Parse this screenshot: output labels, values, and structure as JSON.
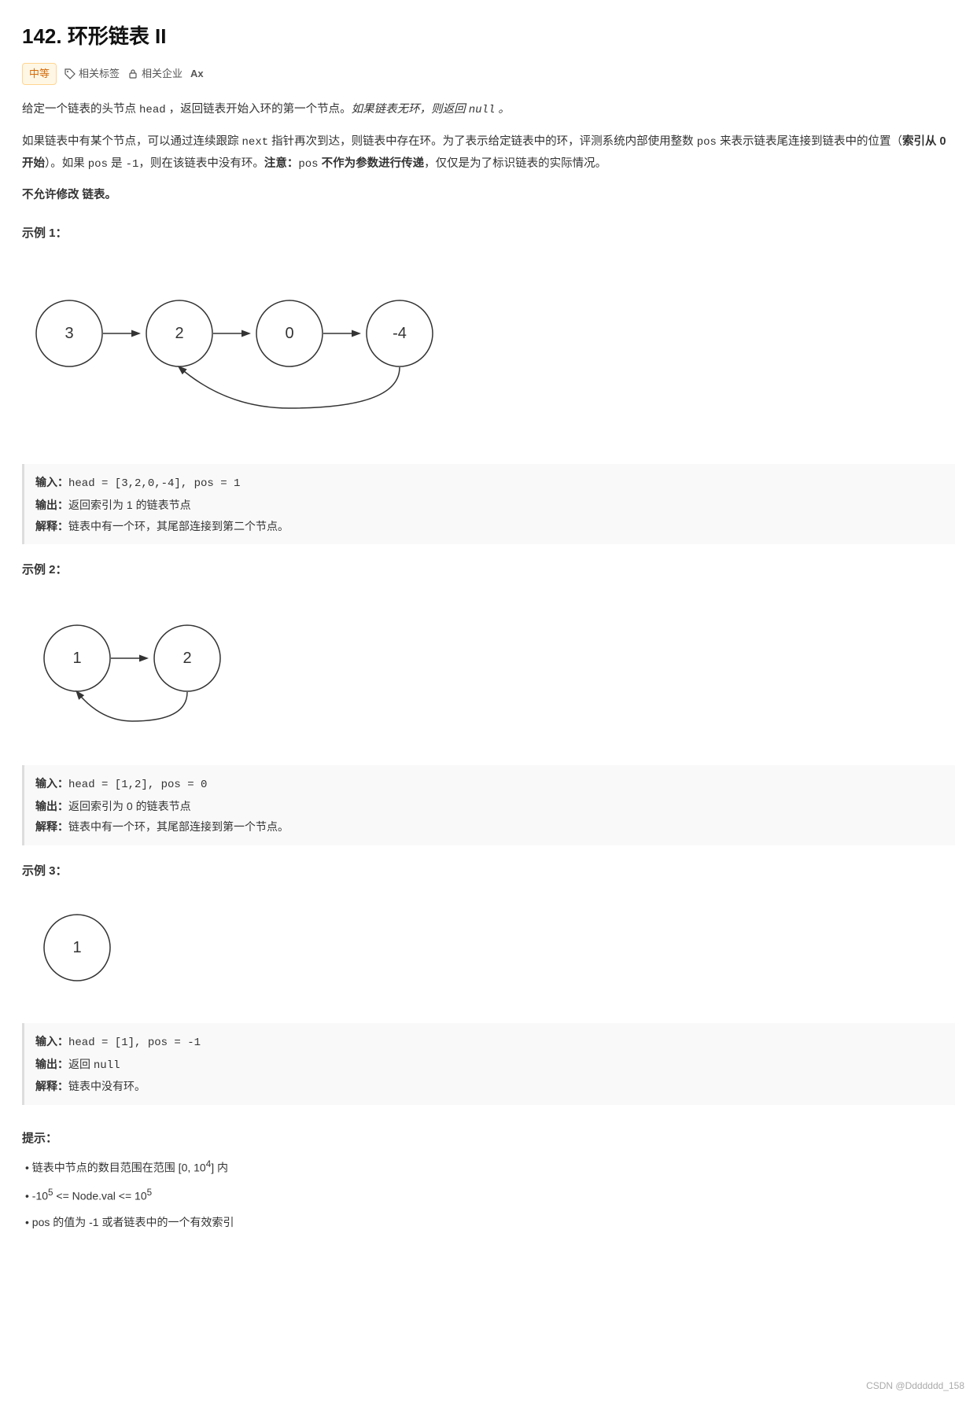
{
  "title": "142. 环形链表 II",
  "difficulty": "中等",
  "tags": [
    {
      "icon": "tag-icon",
      "label": "相关标签"
    },
    {
      "icon": "lock-icon",
      "label": "相关企业"
    },
    {
      "icon": "font-icon",
      "label": "Ax"
    }
  ],
  "description_lines": [
    "给定一个链表的头节点 head ，返回链表开始入环的第一个节点。如果链表无环，则返回 null 。",
    "如果链表中有某个节点，可以通过连续跟踪 next 指针再次到达，则链表中存在环。为了表示给定链表中的环，评测系统内部使用整数 pos 来表示链表尾连接到链表中的位置（索引从 0 开始）。如果 pos 是 -1，则在该链表中没有环。注意：pos 不作为参数进行传递，仅仅是为了标识链表的实际情况。",
    "不允许修改 链表。"
  ],
  "examples": [
    {
      "title": "示例 1：",
      "input": "输入：head = [3,2,0,-4], pos = 1",
      "output": "输出：返回索引为 1 的链表节点",
      "explain": "解释：链表中有一个环，其尾部连接到第二个节点。"
    },
    {
      "title": "示例 2：",
      "input": "输入：head = [1,2], pos = 0",
      "output": "输出：返回索引为 0 的链表节点",
      "explain": "解释：链表中有一个环，其尾部连接到第一个节点。"
    },
    {
      "title": "示例 3：",
      "input": "输入：head = [1], pos = -1",
      "output": "输出：返回 null",
      "explain": "解释：链表中没有环。"
    }
  ],
  "hints": {
    "title": "提示：",
    "items": [
      "链表中节点的数目范围在范围 [0, 10⁴] 内",
      "-10⁵ <= Node.val <= 10⁵",
      "pos 的值为 -1 或者链表中的一个有效索引"
    ]
  },
  "watermark": "CSDN @Ddddddd_158"
}
